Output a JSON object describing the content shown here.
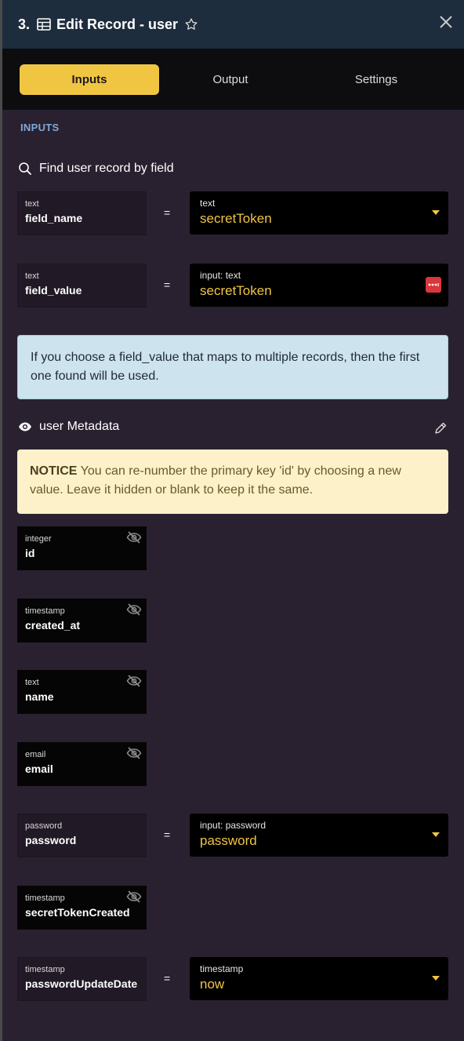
{
  "header": {
    "step": "3.",
    "title": "Edit Record - user"
  },
  "tabs": [
    {
      "label": "Inputs",
      "active": true
    },
    {
      "label": "Output",
      "active": false
    },
    {
      "label": "Settings",
      "active": false
    }
  ],
  "inputs_label": "INPUTS",
  "find_heading": "Find user record by field",
  "find_fields": [
    {
      "type": "text",
      "name": "field_name",
      "value_label": "text",
      "value": "secretToken",
      "control": "dropdown"
    },
    {
      "type": "text",
      "name": "field_value",
      "value_label": "input: text",
      "value": "secretToken",
      "control": "menu"
    }
  ],
  "info_text": "If you choose a field_value that maps to multiple records, then the first one found will be used.",
  "metadata_heading": "user Metadata",
  "notice": {
    "strong": "NOTICE",
    "text": " You can re-number the primary key 'id' by choosing a new value. Leave it hidden or blank to keep it the same."
  },
  "record_fields": [
    {
      "type": "integer",
      "name": "id",
      "hidden": true
    },
    {
      "type": "timestamp",
      "name": "created_at",
      "hidden": true
    },
    {
      "type": "text",
      "name": "name",
      "hidden": true
    },
    {
      "type": "email",
      "name": "email",
      "hidden": true
    },
    {
      "type": "password",
      "name": "password",
      "hidden": false,
      "value_label": "input: password",
      "value": "password"
    },
    {
      "type": "timestamp",
      "name": "secretTokenCreated",
      "hidden": true
    },
    {
      "type": "timestamp",
      "name": "passwordUpdateDate",
      "hidden": false,
      "value_label": "timestamp",
      "value": "now"
    }
  ],
  "equals": "=",
  "colors": {
    "accent": "#f0c542",
    "header_bg": "#1e2d3d",
    "panel_bg": "#2a2130",
    "danger": "#d9373c"
  }
}
